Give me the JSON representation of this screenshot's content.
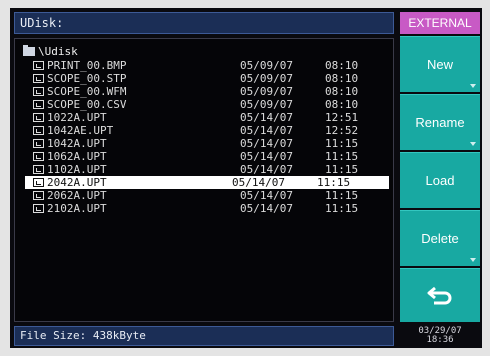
{
  "header": {
    "path": "UDisk:"
  },
  "sidebar": {
    "title": "EXTERNAL",
    "buttons": [
      {
        "label": "New"
      },
      {
        "label": "Rename"
      },
      {
        "label": "Load"
      },
      {
        "label": "Delete"
      }
    ],
    "back_icon": "return-arrow-icon",
    "accent": "#18a9a2",
    "title_color": "#c85ac5"
  },
  "tree": {
    "root": "\\Udisk",
    "files": [
      {
        "name": "PRINT_00.BMP",
        "date": "05/09/07",
        "time": "08:10"
      },
      {
        "name": "SCOPE_00.STP",
        "date": "05/09/07",
        "time": "08:10"
      },
      {
        "name": "SCOPE_00.WFM",
        "date": "05/09/07",
        "time": "08:10"
      },
      {
        "name": "SCOPE_00.CSV",
        "date": "05/09/07",
        "time": "08:10"
      },
      {
        "name": "1022A.UPT",
        "date": "05/14/07",
        "time": "12:51"
      },
      {
        "name": "1042AE.UPT",
        "date": "05/14/07",
        "time": "12:52"
      },
      {
        "name": "1042A.UPT",
        "date": "05/14/07",
        "time": "11:15"
      },
      {
        "name": "1062A.UPT",
        "date": "05/14/07",
        "time": "11:15"
      },
      {
        "name": "1102A.UPT",
        "date": "05/14/07",
        "time": "11:15"
      },
      {
        "name": "2042A.UPT",
        "date": "05/14/07",
        "time": "11:15",
        "selected": true
      },
      {
        "name": "2062A.UPT",
        "date": "05/14/07",
        "time": "11:15"
      },
      {
        "name": "2102A.UPT",
        "date": "05/14/07",
        "time": "11:15"
      }
    ]
  },
  "footer": {
    "file_size": "File Size: 438kByte"
  },
  "clock": {
    "date": "03/29/07",
    "time": "18:36"
  }
}
